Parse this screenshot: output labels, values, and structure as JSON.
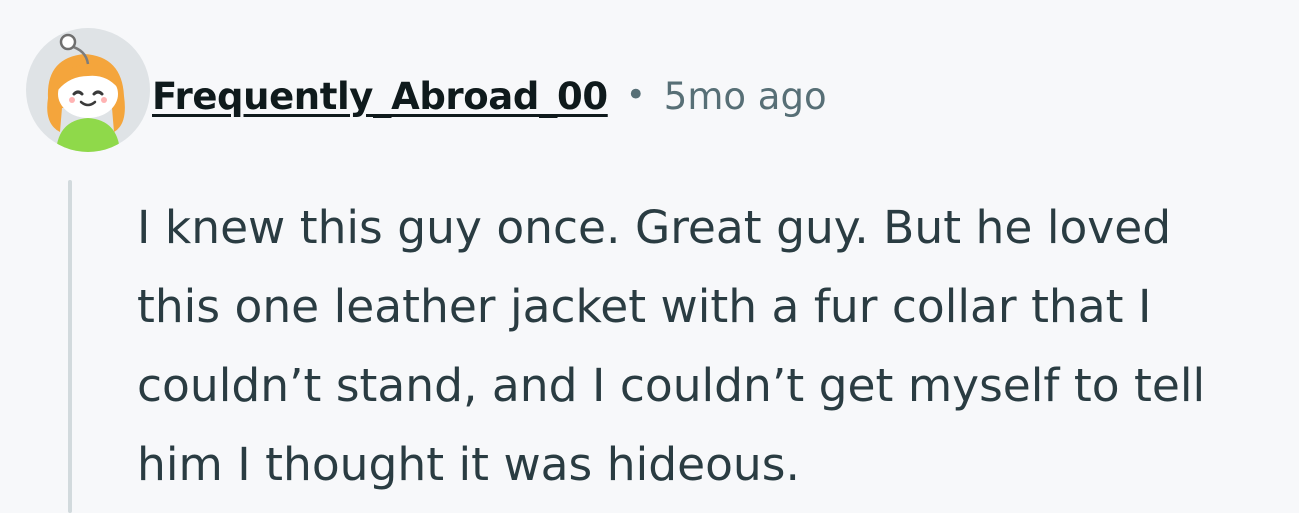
{
  "comment": {
    "author": "Frequently_Abroad_00",
    "separator": "•",
    "timestamp": "5mo ago",
    "avatar_icon": "snoo-avatar-icon",
    "body_lines": [
      "I knew this guy once. Great guy. But he loved",
      "this one leather jacket with a fur collar that I",
      "couldn’t stand, and I couldn’t get myself to tell",
      "him I thought it was hideous."
    ]
  },
  "colors": {
    "background": "#f7f8fa",
    "author": "#0f1a1c",
    "meta": "#576f76",
    "body": "#2a3c42",
    "thread_line": "#d2dadd"
  }
}
